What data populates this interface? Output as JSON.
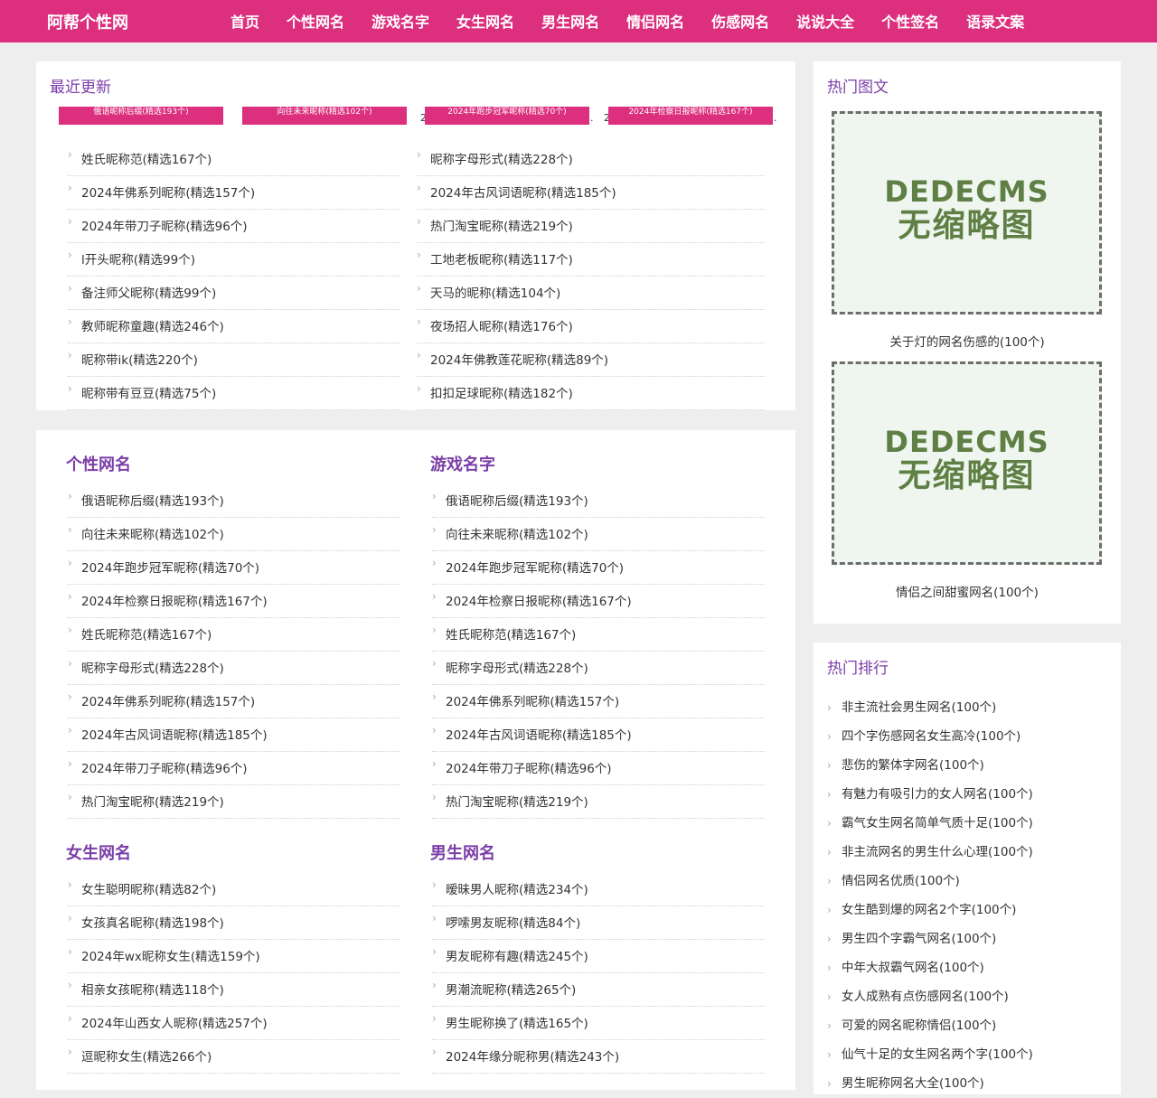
{
  "site": {
    "logo": "阿帮个性网"
  },
  "nav": [
    "首页",
    "个性网名",
    "游戏名字",
    "女生网名",
    "男生网名",
    "情侣网名",
    "伤感网名",
    "说说大全",
    "个性签名",
    "语录文案"
  ],
  "recent": {
    "title": "最近更新",
    "thumbs": [
      "俄语昵称后缀(精选193个)",
      "向往未来昵称(精选102个)",
      "2024年跑步冠军昵称(精选70个)",
      "2024年检察日报昵称(精选167个)"
    ],
    "left": [
      "姓氏昵称范(精选167个)",
      "2024年佛系列昵称(精选157个)",
      "2024年带刀子昵称(精选96个)",
      "l开头昵称(精选99个)",
      "备注师父昵称(精选99个)",
      "教师昵称童趣(精选246个)",
      "昵称带ik(精选220个)",
      "昵称带有豆豆(精选75个)"
    ],
    "right": [
      "昵称字母形式(精选228个)",
      "2024年古风词语昵称(精选185个)",
      "热门淘宝昵称(精选219个)",
      "工地老板昵称(精选117个)",
      "天马的昵称(精选104个)",
      "夜场招人昵称(精选176个)",
      "2024年佛教莲花昵称(精选89个)",
      "扣扣足球昵称(精选182个)"
    ]
  },
  "categories": {
    "gexing": {
      "title": "个性网名",
      "items": [
        "俄语昵称后缀(精选193个)",
        "向往未来昵称(精选102个)",
        "2024年跑步冠军昵称(精选70个)",
        "2024年检察日报昵称(精选167个)",
        "姓氏昵称范(精选167个)",
        "昵称字母形式(精选228个)",
        "2024年佛系列昵称(精选157个)",
        "2024年古风词语昵称(精选185个)",
        "2024年带刀子昵称(精选96个)",
        "热门淘宝昵称(精选219个)"
      ]
    },
    "youxi": {
      "title": "游戏名字",
      "items": [
        "俄语昵称后缀(精选193个)",
        "向往未来昵称(精选102个)",
        "2024年跑步冠军昵称(精选70个)",
        "2024年检察日报昵称(精选167个)",
        "姓氏昵称范(精选167个)",
        "昵称字母形式(精选228个)",
        "2024年佛系列昵称(精选157个)",
        "2024年古风词语昵称(精选185个)",
        "2024年带刀子昵称(精选96个)",
        "热门淘宝昵称(精选219个)"
      ]
    },
    "nvsheng": {
      "title": "女生网名",
      "items": [
        "女生聪明昵称(精选82个)",
        "女孩真名昵称(精选198个)",
        "2024年wx昵称女生(精选159个)",
        "相亲女孩昵称(精选118个)",
        "2024年山西女人昵称(精选257个)",
        "逗昵称女生(精选266个)"
      ]
    },
    "nansheng": {
      "title": "男生网名",
      "items": [
        "暧昧男人昵称(精选234个)",
        "啰嗦男友昵称(精选84个)",
        "男友昵称有趣(精选245个)",
        "男潮流昵称(精选265个)",
        "男生昵称换了(精选165个)",
        "2024年缘分昵称男(精选243个)"
      ]
    }
  },
  "hot_images": {
    "title": "热门图文",
    "placeholder_line1": "DEDECMS",
    "placeholder_line2": "无缩略图",
    "items": [
      "关于灯的网名伤感的(100个)",
      "情侣之间甜蜜网名(100个)"
    ]
  },
  "hot_rank": {
    "title": "热门排行",
    "items": [
      "非主流社会男生网名(100个)",
      "四个字伤感网名女生高冷(100个)",
      "悲伤的繁体字网名(100个)",
      "有魅力有吸引力的女人网名(100个)",
      "霸气女生网名简单气质十足(100个)",
      "非主流网名的男生什么心理(100个)",
      "情侣网名优质(100个)",
      "女生酷到爆的网名2个字(100个)",
      "男生四个字霸气网名(100个)",
      "中年大叔霸气网名(100个)",
      "女人成熟有点伤感网名(100个)",
      "可爱的网名昵称情侣(100个)",
      "仙气十足的女生网名两个字(100个)",
      "男生昵称网名大全(100个)"
    ]
  },
  "chevron_icon": "›"
}
